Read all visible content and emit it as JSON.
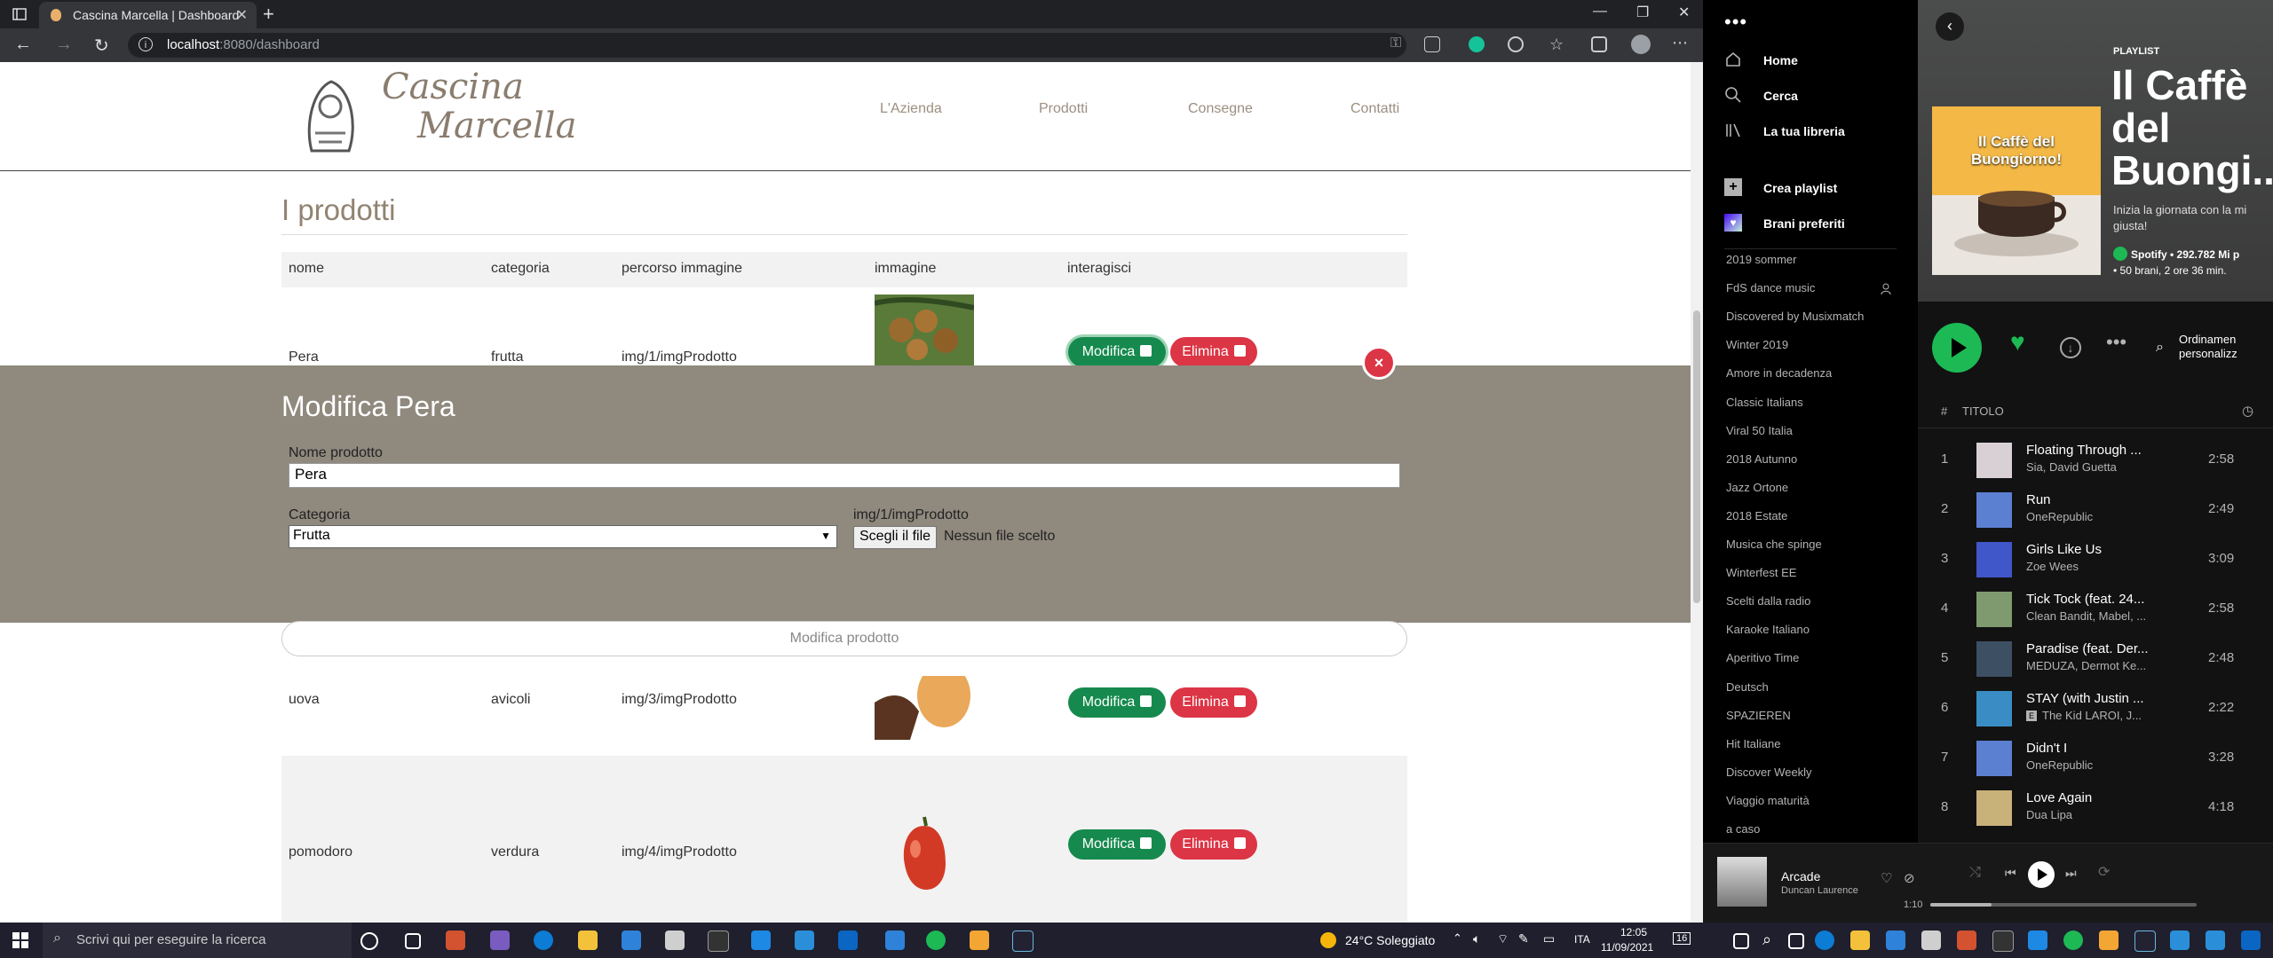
{
  "browser": {
    "tab_title": "Cascina Marcella | Dashboard",
    "url_host": "localhost",
    "url_path": ":8080/dashboard"
  },
  "site": {
    "logo_line1": "Cascina",
    "logo_line2": "Marcella",
    "nav": [
      "L'Azienda",
      "Prodotti",
      "Consegne",
      "Contatti"
    ],
    "section_title": "I prodotti",
    "columns": [
      "nome",
      "categoria",
      "percorso immagine",
      "immagine",
      "interagisci"
    ],
    "rows": [
      {
        "nome": "Pera",
        "categoria": "frutta",
        "percorso": "img/1/imgProdotto",
        "edit": "Modifica",
        "delete": "Elimina"
      },
      {
        "nome": "uova",
        "categoria": "avicoli",
        "percorso": "img/3/imgProdotto",
        "edit": "Modifica",
        "delete": "Elimina"
      },
      {
        "nome": "pomodoro",
        "categoria": "verdura",
        "percorso": "img/4/imgProdotto",
        "edit": "Modifica",
        "delete": "Elimina"
      }
    ]
  },
  "modal": {
    "close_glyph": "×",
    "title": "Modifica Pera",
    "name_label": "Nome prodotto",
    "name_value": "Pera",
    "category_label": "Categoria",
    "category_value": "Frutta",
    "image_label": "img/1/imgProdotto",
    "file_button": "Scegli il file",
    "file_text": "Nessun file scelto",
    "submit": "Modifica prodotto"
  },
  "taskbar": {
    "search_placeholder": "Scrivi qui per eseguire la ricerca",
    "weather": "24°C  Soleggiato",
    "lang": "ITA",
    "time": "12:05",
    "date": "11/09/2021",
    "notifications": "16"
  },
  "spotify": {
    "nav": [
      "Home",
      "Cerca",
      "La tua libreria"
    ],
    "create_playlist": "Crea playlist",
    "liked_songs": "Brani preferiti",
    "playlists": [
      "2019 sommer",
      "FdS dance music",
      "Discovered by Musixmatch",
      "Winter 2019",
      "Amore in decadenza",
      "Classic Italians",
      "Viral 50 Italia",
      "2018 Autunno",
      "Jazz Ortone",
      "2018 Estate",
      "Musica che spinge",
      "Winterfest EE",
      "Scelti dalla radio",
      "Karaoke Italiano",
      "Aperitivo Time",
      "Deutsch",
      "SPAZIEREN",
      "Hit Italiane",
      "Discover Weekly",
      "Viaggio maturità",
      "a caso"
    ],
    "playlist_type": "PLAYLIST",
    "playlist_title_1": "Il Caffè",
    "playlist_title_2": "del",
    "playlist_title_3": "Buongi...",
    "cover_caption_1": "Il Caffè del",
    "cover_caption_2": "Buongiorno!",
    "description_1": "Inizia la giornata con la mi",
    "description_2": "giusta!",
    "meta_1": "Spotify • 292.782 Mi p",
    "meta_2": "• 50 brani, 2 ore 36 min.",
    "sort_1": "Ordinamen",
    "sort_2": "personalizz",
    "col_hash": "#",
    "col_title": "TITOLO",
    "tracks": [
      {
        "n": "1",
        "title": "Floating Through ...",
        "artist": "Sia, David Guetta",
        "dur": "2:58",
        "explicit": false
      },
      {
        "n": "2",
        "title": "Run",
        "artist": "OneRepublic",
        "dur": "2:49",
        "explicit": false
      },
      {
        "n": "3",
        "title": "Girls Like Us",
        "artist": "Zoe Wees",
        "dur": "3:09",
        "explicit": false
      },
      {
        "n": "4",
        "title": "Tick Tock (feat. 24...",
        "artist": "Clean Bandit, Mabel, ...",
        "dur": "2:58",
        "explicit": false
      },
      {
        "n": "5",
        "title": "Paradise (feat. Der...",
        "artist": "MEDUZA, Dermot Ke...",
        "dur": "2:48",
        "explicit": false
      },
      {
        "n": "6",
        "title": "STAY (with Justin ...",
        "artist": "The Kid LAROI, J...",
        "dur": "2:22",
        "explicit": true
      },
      {
        "n": "7",
        "title": "Didn't I",
        "artist": "OneRepublic",
        "dur": "3:28",
        "explicit": false
      },
      {
        "n": "8",
        "title": "Love Again",
        "artist": "Dua Lipa",
        "dur": "4:18",
        "explicit": false
      }
    ],
    "now_playing": {
      "title": "Arcade",
      "artist": "Duncan Laurence",
      "elapsed": "1:10",
      "progress": 0.23
    },
    "explicit_badge": "E"
  },
  "colors": {
    "accent_green": "#168a4e",
    "danger_red": "#dc3545",
    "spotify_green": "#1db954",
    "modal_bg": "#8f897e"
  }
}
